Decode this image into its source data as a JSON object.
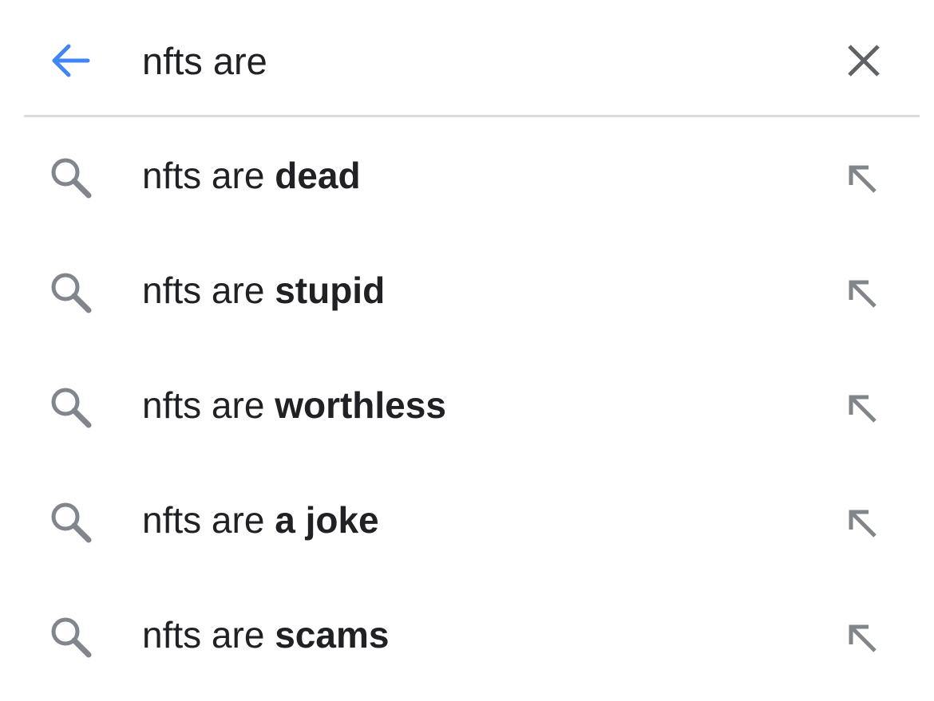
{
  "search": {
    "query": "nfts are"
  },
  "suggestions": [
    {
      "prefix": "nfts are ",
      "completion": "dead"
    },
    {
      "prefix": "nfts are ",
      "completion": "stupid"
    },
    {
      "prefix": "nfts are ",
      "completion": "worthless"
    },
    {
      "prefix": "nfts are ",
      "completion": "a joke"
    },
    {
      "prefix": "nfts are ",
      "completion": "scams"
    }
  ],
  "icons": {
    "back": "arrow-left-icon",
    "clear": "close-icon",
    "suggestion": "search-icon",
    "fill_query": "arrow-up-left-icon"
  },
  "colors": {
    "back_arrow": "#4285f4",
    "icon_gray": "#80868b",
    "clear_gray": "#5f6368",
    "divider": "#dadce0",
    "text": "#202124"
  }
}
